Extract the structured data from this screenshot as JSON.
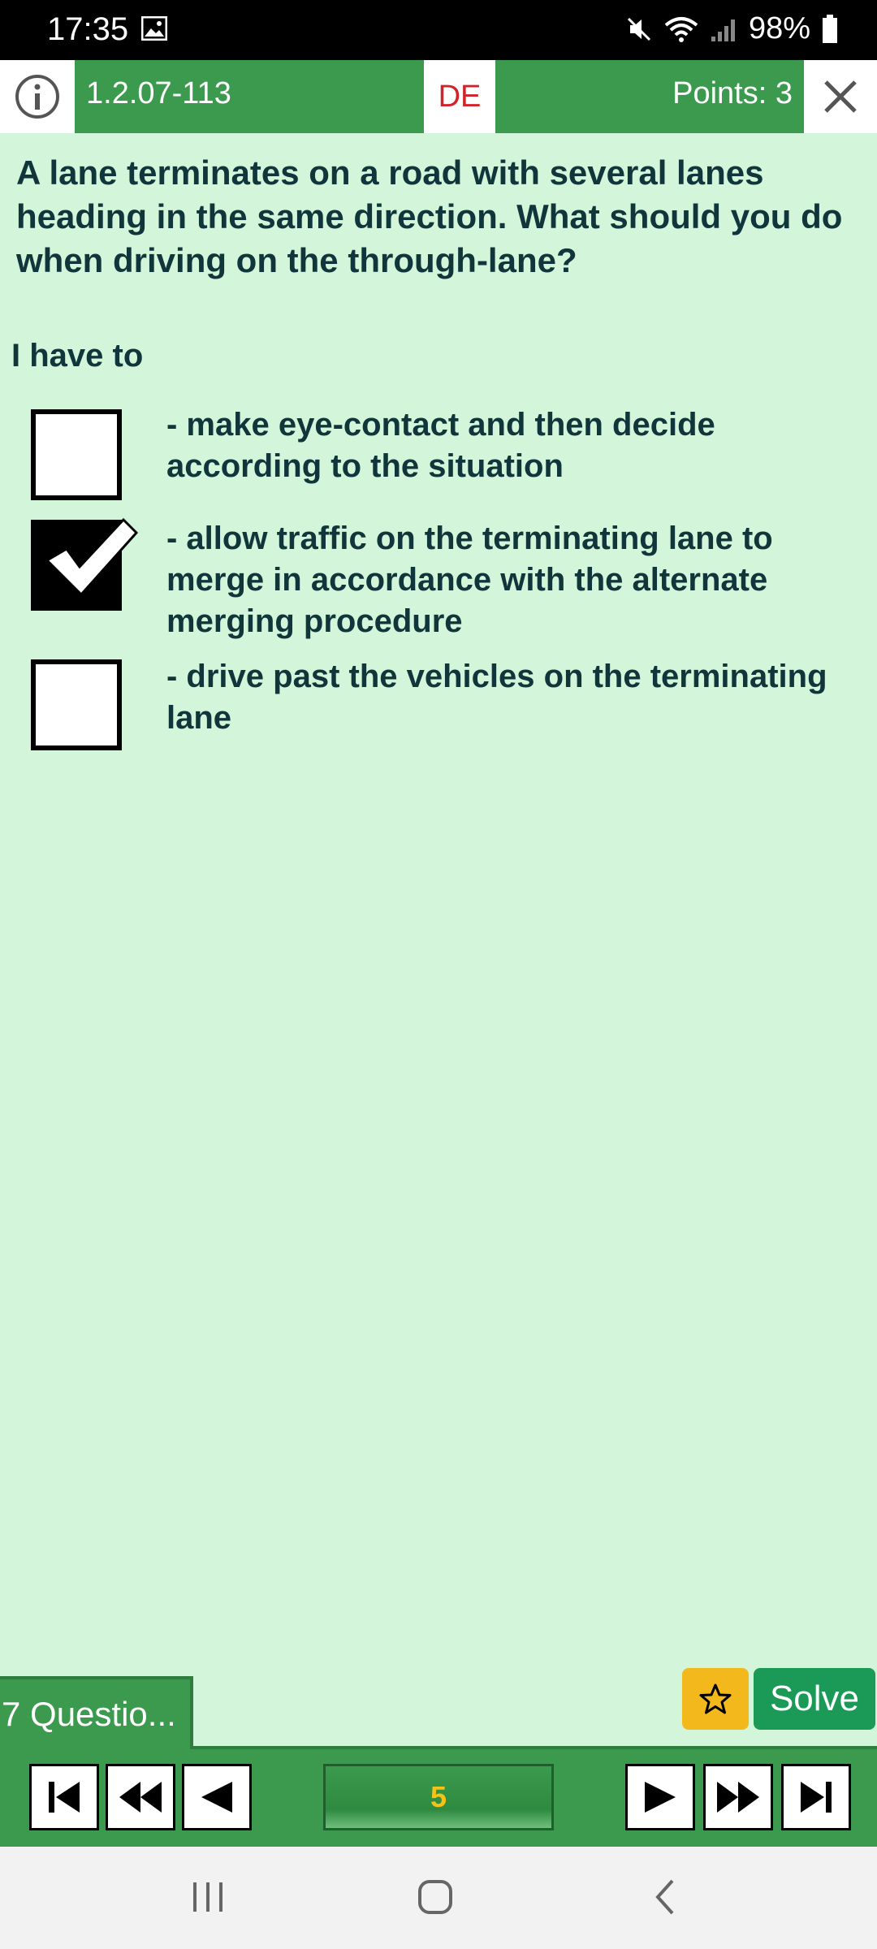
{
  "status_bar": {
    "time": "17:35",
    "battery": "98%"
  },
  "header": {
    "question_id": "1.2.07-113",
    "language": "DE",
    "points": "Points: 3"
  },
  "question": "A lane terminates on a road with several lanes heading in the same direction. What should you do when driving on the through-lane?",
  "prompt": "I have to",
  "answers": [
    {
      "text": "- make eye-contact and then decide according to the situation",
      "checked": false
    },
    {
      "text": "- allow traffic on the terminating lane to merge in accordance with the alternate merging procedure",
      "checked": true
    },
    {
      "text": "- drive past the vehicles on the terminating lane",
      "checked": false
    }
  ],
  "bottom": {
    "questions_tab": "7 Questio...",
    "solve_label": "Solve",
    "current_page": "5"
  },
  "colors": {
    "background": "#d3f5da",
    "green": "#3b9a4d",
    "text": "#10353a",
    "language": "#d2232a",
    "favorite": "#f3b81c",
    "solve": "#1a9a56",
    "page_number": "#f3c316"
  },
  "icons": [
    "picture-icon",
    "mute-icon",
    "wifi-icon",
    "signal-icon",
    "battery-icon",
    "info-icon",
    "close-icon",
    "check-icon",
    "star-icon",
    "first-page-icon",
    "rewind-icon",
    "previous-icon",
    "next-icon",
    "fast-forward-icon",
    "last-page-icon",
    "recent-apps-icon",
    "home-icon",
    "back-icon"
  ]
}
